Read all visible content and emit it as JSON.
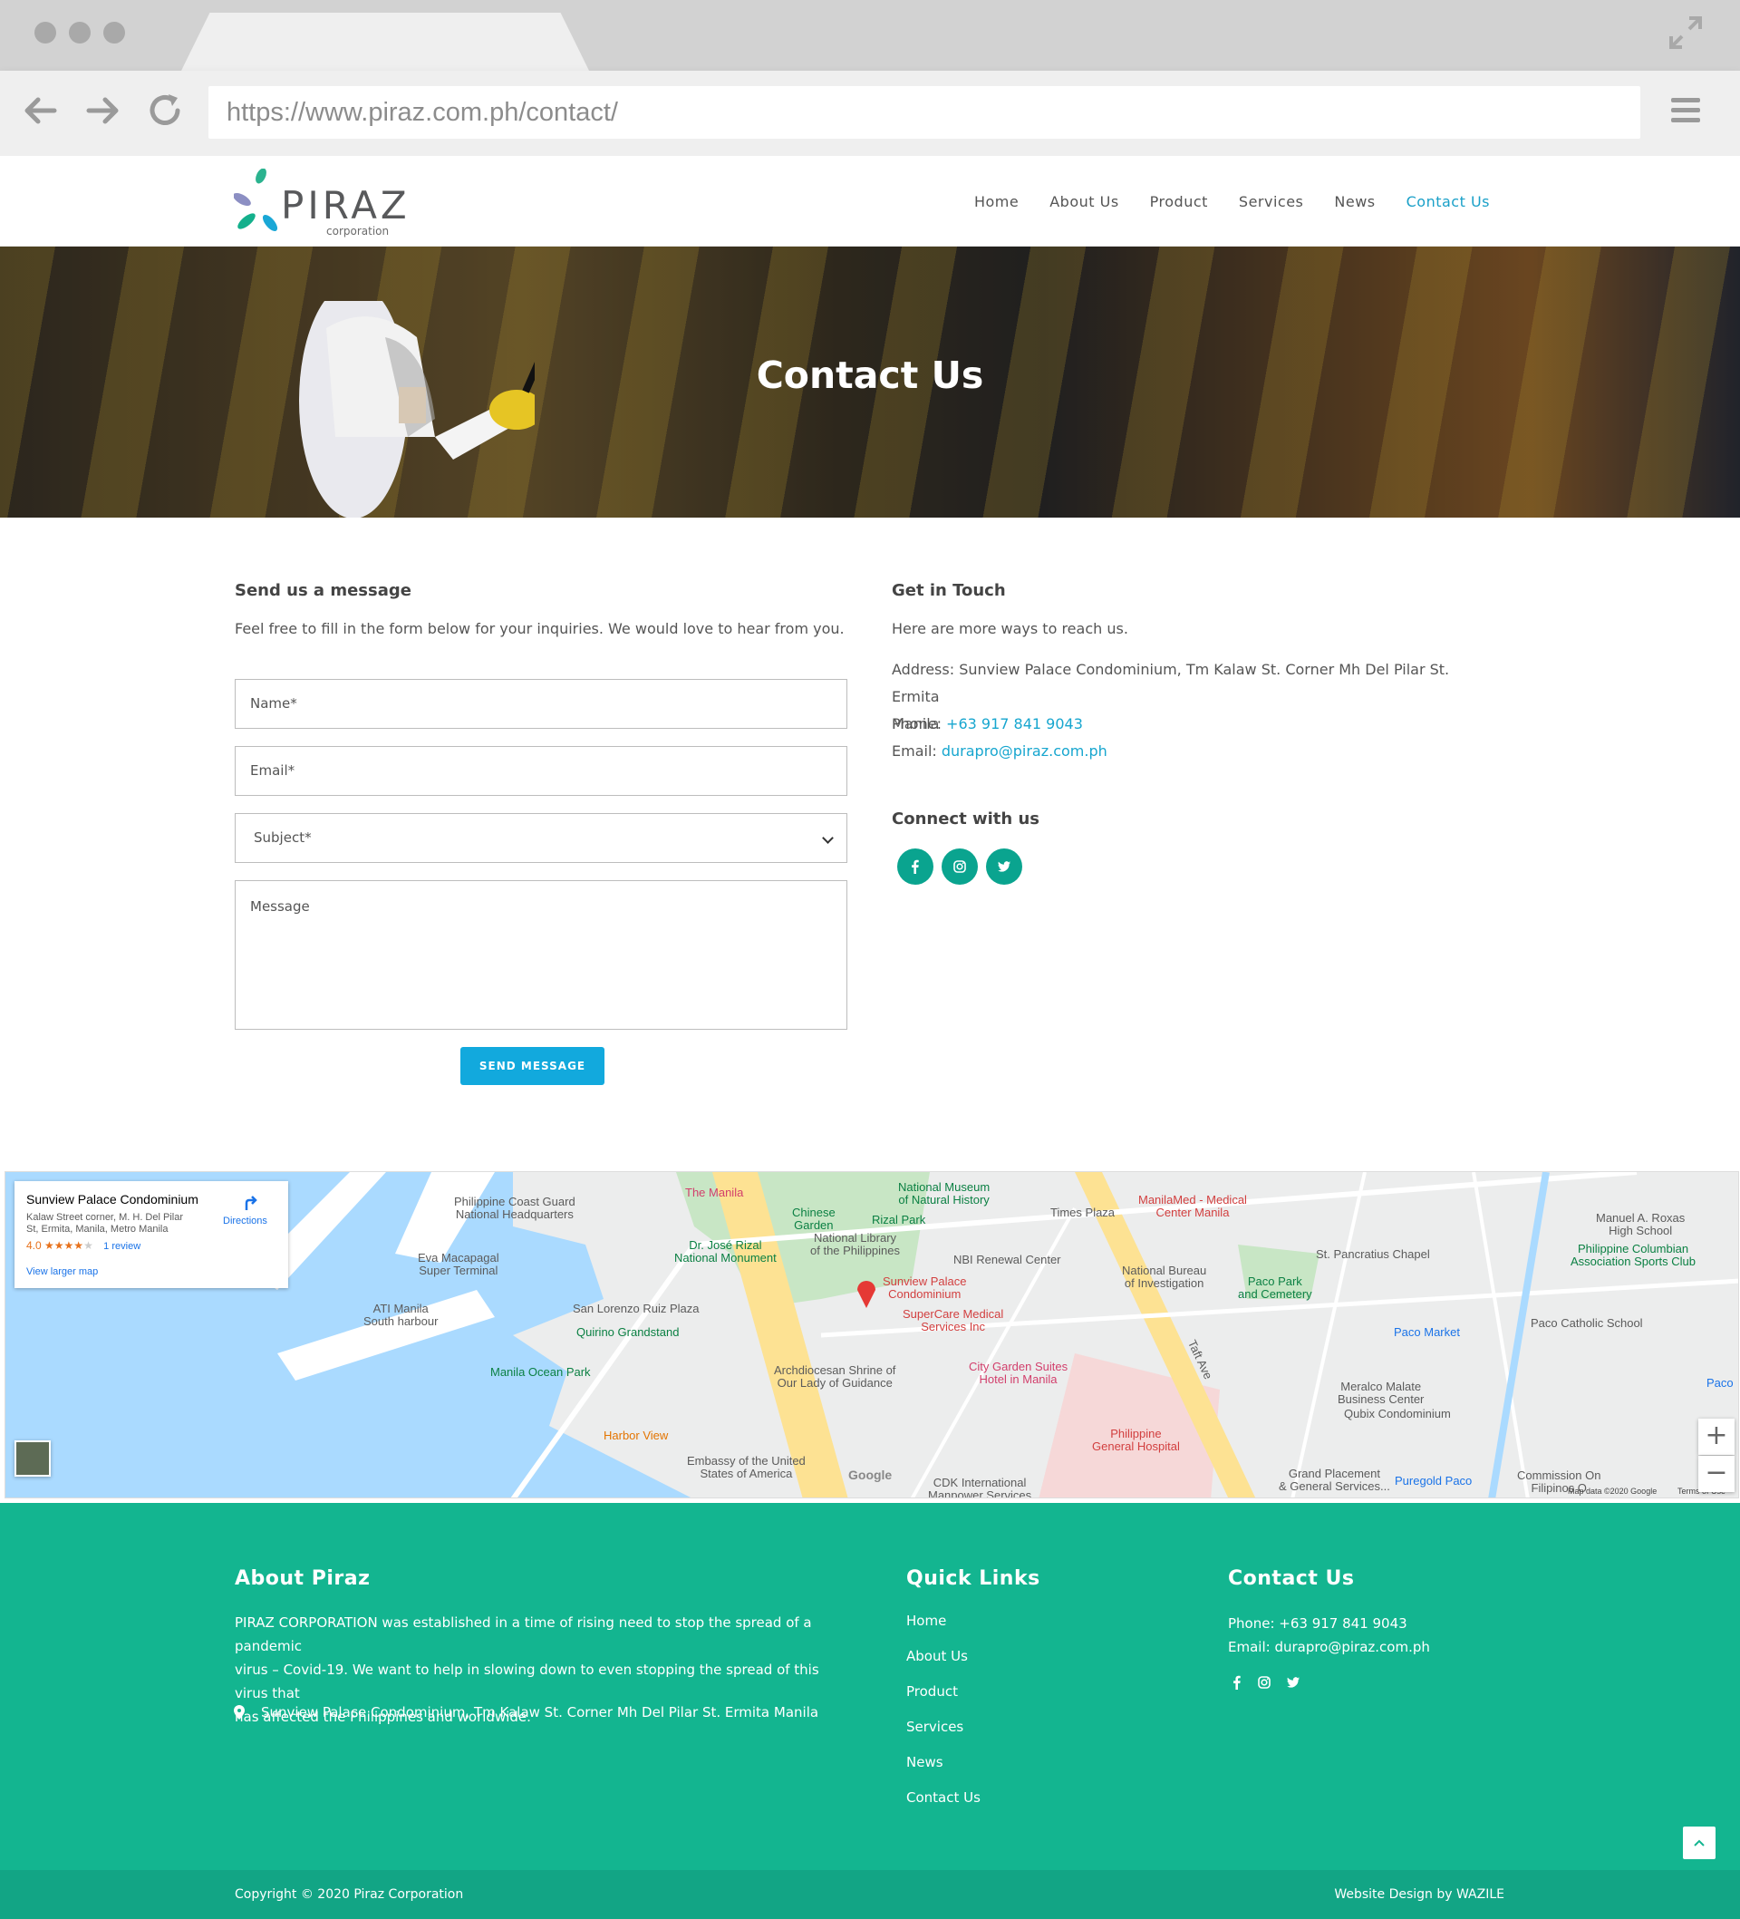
{
  "browser": {
    "url": "https://www.piraz.com.ph/contact/"
  },
  "header": {
    "logo_text": "PIRAZ",
    "logo_sub": "corporation",
    "nav": [
      {
        "label": "Home"
      },
      {
        "label": "About Us"
      },
      {
        "label": "Product"
      },
      {
        "label": "Services"
      },
      {
        "label": "News"
      },
      {
        "label": "Contact Us"
      }
    ]
  },
  "hero": {
    "title": "Contact Us"
  },
  "form": {
    "title": "Send us a message",
    "intro": "Feel free to fill in the form below for your inquiries. We would love to hear from you.",
    "name_placeholder": "Name*",
    "email_placeholder": "Email*",
    "subject_selected": "Subject*",
    "message_placeholder": "Message",
    "submit_label": "SEND MESSAGE"
  },
  "touch": {
    "title": "Get in Touch",
    "intro": "Here are more ways to reach us.",
    "address_label": "Address: ",
    "address_line1": "Sunview Palace Condominium, Tm Kalaw St. Corner Mh Del Pilar St. Ermita",
    "address_line2": "Manila",
    "phone_label": "Phone: ",
    "phone": "+63 917 841 9043",
    "email_label": "Email: ",
    "email": "durapro@piraz.com.ph",
    "connect_title": "Connect with us"
  },
  "map": {
    "place_name": "Sunview Palace Condominium",
    "place_address_1": "Kalaw Street corner, M. H. Del Pilar",
    "place_address_2": "St, Ermita, Manila, Metro Manila",
    "rating": "4.0",
    "stars": "★★★★",
    "star_empty": "★",
    "reviews": "1 review",
    "larger_map": "View larger map",
    "directions": "Directions",
    "attribution": "Map data ©2020 Google",
    "terms": "Terms of Use",
    "google": "Google",
    "zoom_in": "+",
    "zoom_out": "−",
    "labels": [
      "Philippine Coast Guard",
      "National Headquarters",
      "The Manila",
      "Chinese",
      "Garden",
      "National Museum",
      "of Natural History",
      "Rizal Park",
      "Times Plaza",
      "ManilaMed - Medical",
      "Center Manila",
      "Dr. José Rizal",
      "National Monument",
      "National Library",
      "of the Philippines",
      "Eva Macapagal",
      "Super Terminal",
      "NBI Renewal Center",
      "Sunview Palace",
      "Condominium",
      "National Bureau",
      "of Investigation",
      "St. Pancratius Chapel",
      "Manuel A. Roxas",
      "High School",
      "Philippine Columbian",
      "Association Sports Club",
      "San Lorenzo Ruiz Plaza",
      "ATI Manila",
      "South harbour",
      "Quirino Grandstand",
      "SuperCare Medical",
      "Services Inc",
      "Paco Park",
      "and Cemetery",
      "Paco Market",
      "Paco Catholic School",
      "Manila Ocean Park",
      "Archdiocesan Shrine of",
      "Our Lady of Guidance",
      "City Garden Suites",
      "Hotel in Manila",
      "Taft Ave",
      "Meralco Malate",
      "Business Center",
      "Qubix Condominium",
      "Harbor View",
      "Philippine",
      "General Hospital",
      "Embassy of the United",
      "States of America",
      "CDK International",
      "Manpower Services",
      "Grand Placement",
      "& General Services...",
      "Puregold Paco",
      "Commission On",
      "Filipinos O",
      "Paco"
    ]
  },
  "footer": {
    "about_title": "About Piraz",
    "about_text_1": "PIRAZ CORPORATION was established in a time of rising need to stop the spread of a pandemic",
    "about_text_2": "virus – Covid-19. We want to help in slowing down to even stopping the spread of this virus that",
    "about_text_3": "has affected the Philippines and worldwide.",
    "address": "Sunview Palace Condominium, Tm Kalaw St. Corner Mh Del Pilar St. Ermita Manila",
    "links_title": "Quick Links",
    "links": [
      "Home",
      "About Us",
      "Product",
      "Services",
      "News",
      "Contact Us"
    ],
    "contact_title": "Contact Us",
    "phone": "Phone: +63 917 841 9043",
    "email": "Email: durapro@piraz.com.ph",
    "copyright": "Copyright © 2020 Piraz Corporation",
    "design": "Website Design by WAZILE"
  },
  "colors": {
    "accent": "#1aa0c8",
    "footer": "#13b590",
    "button": "#12a9dd",
    "social": "#0aa48f"
  }
}
